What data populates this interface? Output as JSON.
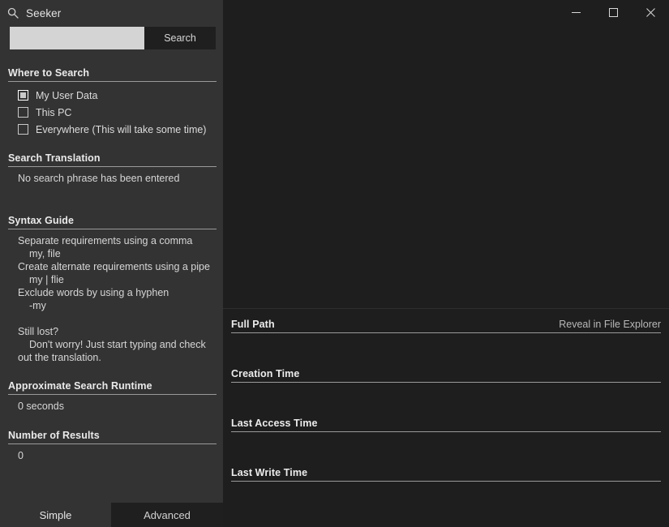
{
  "window": {
    "controls": [
      {
        "name": "minimize",
        "glyph": "minimize-icon"
      },
      {
        "name": "maximize",
        "glyph": "maximize-icon"
      },
      {
        "name": "close",
        "glyph": "close-icon"
      }
    ]
  },
  "app": {
    "title": "Seeker",
    "icon": "search-icon"
  },
  "search": {
    "value": "",
    "placeholder": "",
    "button_label": "Search"
  },
  "where_to_search": {
    "heading": "Where to Search",
    "options": [
      {
        "label": "My User Data",
        "checked": true
      },
      {
        "label": "This PC",
        "checked": false
      },
      {
        "label": "Everywhere (This will take some time)",
        "checked": false
      }
    ]
  },
  "search_translation": {
    "heading": "Search Translation",
    "value": "No search phrase has been entered"
  },
  "syntax_guide": {
    "heading": "Syntax Guide",
    "lines": [
      {
        "text": "Separate requirements using a comma",
        "indent": false
      },
      {
        "text": "my, file",
        "indent": true
      },
      {
        "text": "Create alternate requirements using a pipe",
        "indent": false
      },
      {
        "text": "my | flie",
        "indent": true
      },
      {
        "text": "Exclude words by using a hyphen",
        "indent": false
      },
      {
        "text": "-my",
        "indent": true
      }
    ],
    "still_lost_title": "Still lost?",
    "still_lost_body": "Don't worry! Just start typing and check out the translation."
  },
  "runtime": {
    "heading": "Approximate Search Runtime",
    "value": "0 seconds"
  },
  "results_count": {
    "heading": "Number of Results",
    "value": "0"
  },
  "tabs": [
    {
      "label": "Simple",
      "active": true
    },
    {
      "label": "Advanced",
      "active": false
    }
  ],
  "details": {
    "full_path": {
      "heading": "Full Path",
      "action_label": "Reveal in File Explorer",
      "value": ""
    },
    "creation_time": {
      "heading": "Creation Time",
      "value": ""
    },
    "last_access_time": {
      "heading": "Last Access Time",
      "value": ""
    },
    "last_write_time": {
      "heading": "Last Write Time",
      "value": ""
    }
  },
  "colors": {
    "left_panel_bg": "#333333",
    "right_panel_bg": "#1e1e1e",
    "control_bg": "#1f1f1f",
    "input_bg": "#d4d4d4",
    "text": "#dcdcdc",
    "rule": "#9a9a9a"
  }
}
